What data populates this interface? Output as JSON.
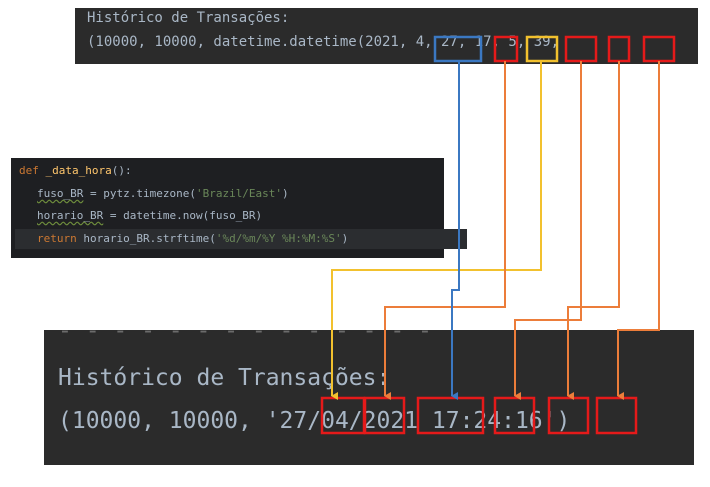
{
  "console_top": {
    "line1": "Histórico de Transações:",
    "line2": "(10000, 10000, datetime.datetime(2021, 4, 27, 17, 5, 39,"
  },
  "code": {
    "line1_kw": "def",
    "line1_fn": "_data_hora",
    "line1_rest": "():",
    "line2_var": "fuso_BR",
    "line2_mid": " = pytz.timezone(",
    "line2_str": "'Brazil/East'",
    "line2_end": ")",
    "line3_var": "horario_BR",
    "line3_rest": " = datetime.now(fuso_BR)",
    "line4_kw": "return",
    "line4_mid": " horario_BR.strftime(",
    "line4_str": "'%d/%m/%Y %H:%M:%S'",
    "line4_end": ")"
  },
  "console_bottom": {
    "dashes": "- - - - - - - - - - - - - -",
    "line1": "Histórico de Transações:",
    "line2": "(10000, 10000, '27/04/2021 17:24:16')"
  },
  "colors": {
    "year_box": "#3b78c2",
    "day_box": "#f2c12e",
    "mapping_line": "#ec7d3a",
    "highlight_box": "#e51a1a"
  }
}
